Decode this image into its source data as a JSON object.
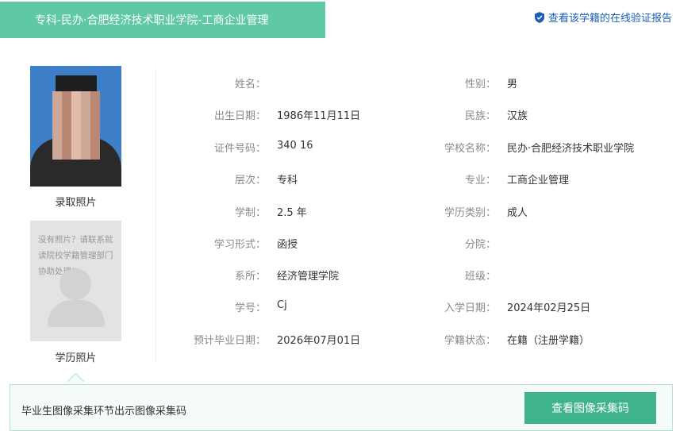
{
  "header": {
    "title": "专科-民办·合肥经济技术职业学院-工商企业管理",
    "verify_link": "查看该学籍的在线验证报告"
  },
  "photos": {
    "admission_label": "录取照片",
    "degree_label": "学历照片",
    "degree_placeholder_note": "没有照片？请联系就读院校学籍管理部门协助处理！"
  },
  "fields_left": [
    {
      "label": "姓名：",
      "value": ""
    },
    {
      "label": "出生日期：",
      "value": "1986年11月11日"
    },
    {
      "label": "证件号码：",
      "value": "340        16"
    },
    {
      "label": "层次：",
      "value": "专科"
    },
    {
      "label": "学制：",
      "value": "2.5 年"
    },
    {
      "label": "学习形式：",
      "value": "函授"
    },
    {
      "label": "系所：",
      "value": "经济管理学院"
    },
    {
      "label": "学号：",
      "value": "Cj"
    },
    {
      "label": "预计毕业日期：",
      "value": "2026年07月01日"
    }
  ],
  "fields_right": [
    {
      "label": "性别：",
      "value": "男"
    },
    {
      "label": "民族：",
      "value": "汉族"
    },
    {
      "label": "学校名称：",
      "value": "民办·合肥经济技术职业学院"
    },
    {
      "label": "专业：",
      "value": "工商企业管理"
    },
    {
      "label": "学历类别：",
      "value": "成人"
    },
    {
      "label": "分院：",
      "value": ""
    },
    {
      "label": "班级：",
      "value": ""
    },
    {
      "label": "入学日期：",
      "value": "2024年02月25日"
    },
    {
      "label": "学籍状态：",
      "value": "在籍（注册学籍）"
    }
  ],
  "capture": {
    "text": "毕业生图像采集环节出示图像采集码",
    "button": "查看图像采集码"
  },
  "colors": {
    "banner": "#5ec9a3",
    "button": "#3fb38a",
    "link": "#1a5fb4"
  }
}
